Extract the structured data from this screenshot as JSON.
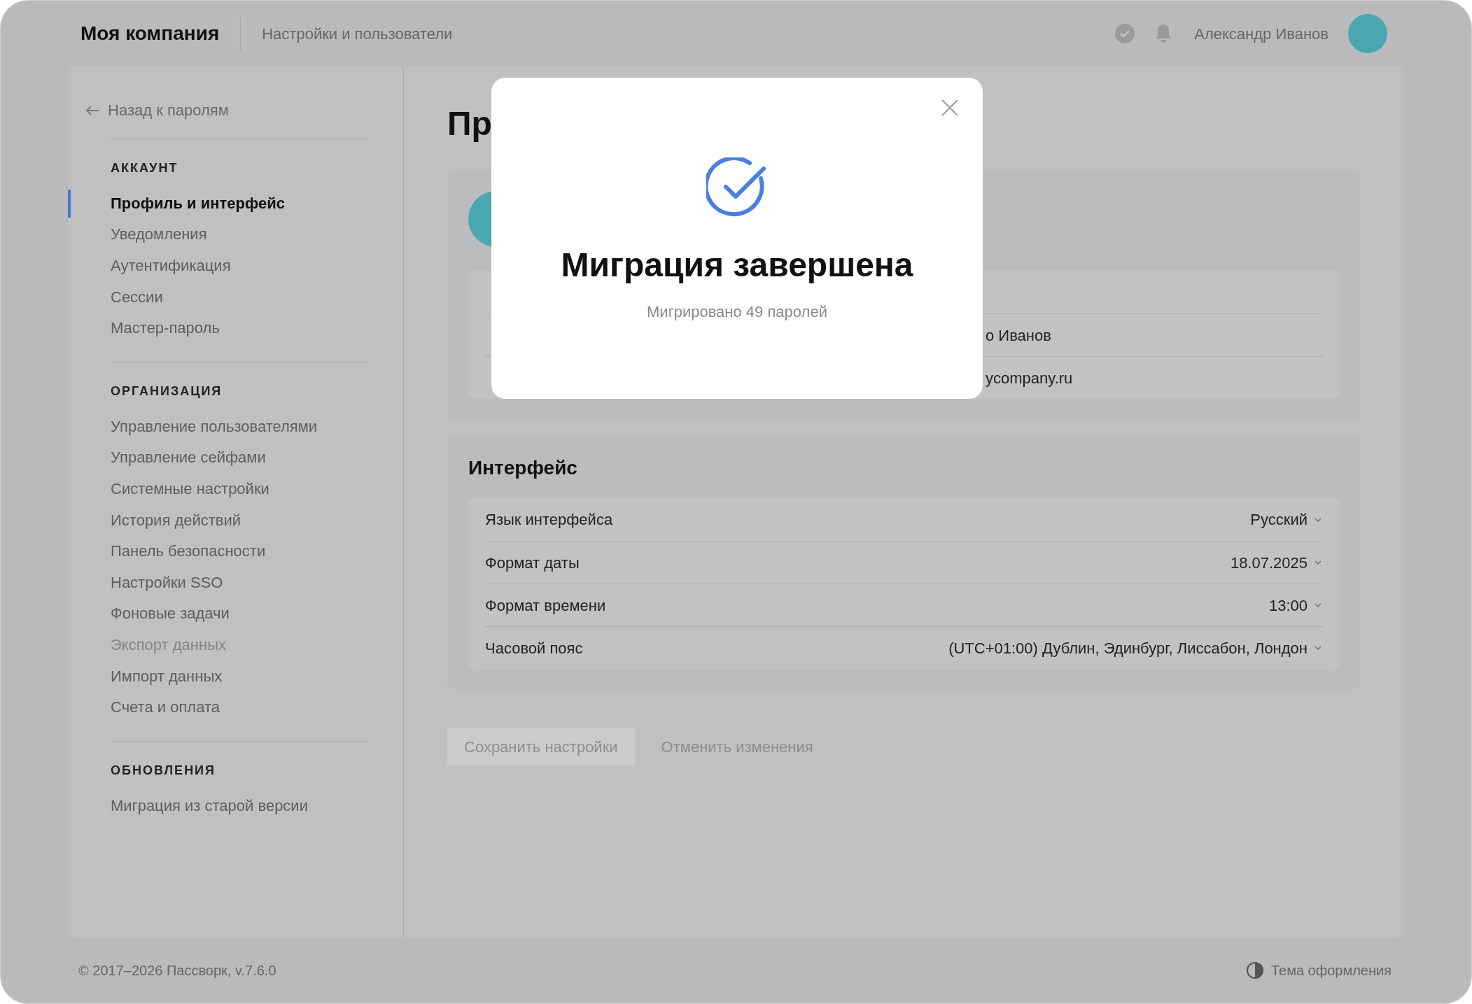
{
  "header": {
    "brand": "Моя компания",
    "section": "Настройки и пользователи",
    "user_name": "Александр Иванов"
  },
  "sidebar": {
    "back_link": "Назад к паролям",
    "groups": [
      {
        "title": "АККАУНТ",
        "items": [
          {
            "label": "Профиль и интерфейс",
            "selected": true,
            "disabled": false
          },
          {
            "label": "Уведомления",
            "selected": false,
            "disabled": false
          },
          {
            "label": "Аутентификация",
            "selected": false,
            "disabled": false
          },
          {
            "label": "Сессии",
            "selected": false,
            "disabled": false
          },
          {
            "label": "Мастер-пароль",
            "selected": false,
            "disabled": false
          }
        ]
      },
      {
        "title": "ОРГАНИЗАЦИЯ",
        "items": [
          {
            "label": "Управление пользователями",
            "selected": false,
            "disabled": false
          },
          {
            "label": "Управление сейфами",
            "selected": false,
            "disabled": false
          },
          {
            "label": "Системные настройки",
            "selected": false,
            "disabled": false
          },
          {
            "label": "История действий",
            "selected": false,
            "disabled": false
          },
          {
            "label": "Панель безопасности",
            "selected": false,
            "disabled": false
          },
          {
            "label": "Настройки SSO",
            "selected": false,
            "disabled": false
          },
          {
            "label": "Фоновые задачи",
            "selected": false,
            "disabled": false
          },
          {
            "label": "Экспорт данных",
            "selected": false,
            "disabled": true
          },
          {
            "label": "Импорт данных",
            "selected": false,
            "disabled": false
          },
          {
            "label": "Счета и оплата",
            "selected": false,
            "disabled": false
          }
        ]
      },
      {
        "title": "ОБНОВЛЕНИЯ",
        "items": [
          {
            "label": "Миграция из старой версии",
            "selected": false,
            "disabled": false
          }
        ]
      }
    ]
  },
  "page": {
    "title": "Пр",
    "profile_rows": [
      {
        "value": "о Иванов"
      },
      {
        "value": "ycompany.ru"
      }
    ],
    "interface": {
      "title": "Интерфейс",
      "rows": [
        {
          "label": "Язык интерфейса",
          "value": "Русский"
        },
        {
          "label": "Формат даты",
          "value": "18.07.2025"
        },
        {
          "label": "Формат времени",
          "value": "13:00"
        },
        {
          "label": "Часовой пояс",
          "value": "(UTC+01:00) Дублин, Эдинбург, Лиссабон, Лондон"
        }
      ]
    },
    "save_button": {
      "label": "Сохранить настройки",
      "disabled": true
    },
    "cancel_button": {
      "label": "Отменить изменения"
    }
  },
  "modal": {
    "title": "Миграция завершена",
    "subtitle": "Мигрировано 49 паролей"
  },
  "footer": {
    "copyright": "© 2017–2026 Пассворк, v.7.6.0",
    "theme_toggle": "Тема оформления"
  }
}
